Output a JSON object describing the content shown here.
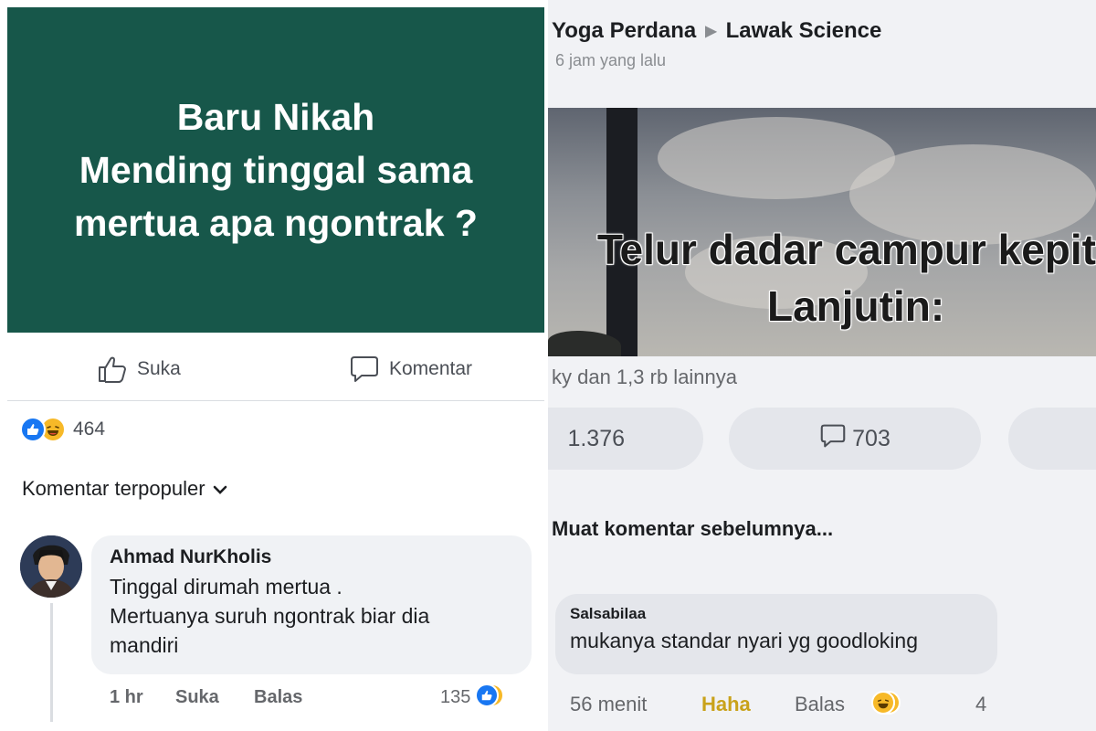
{
  "left": {
    "post_lines": [
      "Baru Nikah",
      "Mending tinggal sama",
      "mertua apa ngontrak ?"
    ],
    "post_bg": "#17574a",
    "actions": {
      "like_label": "Suka",
      "comment_label": "Komentar"
    },
    "reactions": {
      "icons": [
        "like-icon",
        "haha-icon"
      ],
      "count": "464"
    },
    "sort_label": "Komentar terpopuler",
    "comment": {
      "author": "Ahmad NurKholis",
      "lines": [
        "Tinggal dirumah mertua .",
        "Mertuanya suruh ngontrak biar dia",
        "mandiri"
      ],
      "time": "1 hr",
      "like_label": "Suka",
      "reply_label": "Balas",
      "reaction_count": "135"
    }
  },
  "right": {
    "author": "Yoga Perdana",
    "group": "Lawak Science",
    "time": "6 jam yang lalu",
    "image_caption": [
      "Telur dadar campur kepit",
      "Lanjutin:"
    ],
    "reacted_by": "ky dan 1,3 rb lainnya",
    "reaction_count": "1.376",
    "comment_count": "703",
    "load_previous": "Muat komentar sebelumnya...",
    "comment": {
      "author": "Salsabilaa",
      "text": "mukanya standar nyari yg goodloking",
      "time": "56 menit",
      "haha_label": "Haha",
      "reply_label": "Balas",
      "reaction_count": "4"
    }
  },
  "colors": {
    "facebook_blue": "#1877f2",
    "haha_yellow": "#f7b928",
    "muted": "#65676b"
  }
}
